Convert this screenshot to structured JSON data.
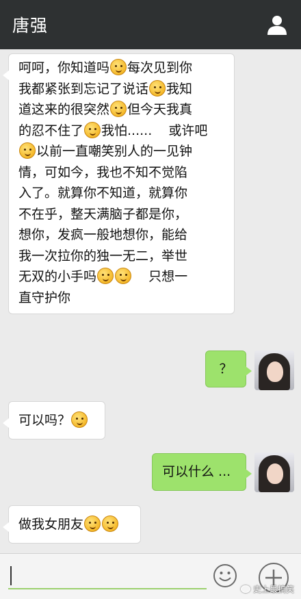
{
  "header": {
    "title": "唐强",
    "profile_icon": "person-icon"
  },
  "messages": [
    {
      "side": "left",
      "lines": [
        [
          "呵呵，你知道吗",
          "E",
          "每次见到你"
        ],
        [
          "我都紧张到忘记了说话",
          "E",
          "我知"
        ],
        [
          "道这来的很突然",
          "E",
          "但今天我真"
        ],
        [
          "的忍不住了",
          "E",
          "我怕......    或许吧"
        ],
        [
          "E",
          "以前一直嘲笑别人的一见钟"
        ],
        [
          "情，可如今，我也不知不觉陷"
        ],
        [
          "入了。就算你不知道，就算你"
        ],
        [
          "不在乎，整天满脑子都是你，"
        ],
        [
          "想你，发疯一般地想你，能给"
        ],
        [
          "我一次拉你的独一无二，举世"
        ],
        [
          "无双的小手吗",
          "E",
          "E",
          "    只想一"
        ],
        [
          "直守护你"
        ]
      ]
    },
    {
      "side": "right",
      "text": "？"
    },
    {
      "side": "left",
      "text": "可以吗？"
    },
    {
      "side": "right",
      "text": "可以什么 ..."
    },
    {
      "side": "left",
      "text": "做我女朋友"
    }
  ],
  "input": {
    "value": ""
  },
  "watermark": "史上最搞笑",
  "colors": {
    "topbar": "#2e3132",
    "sent_bubble": "#9de26c",
    "background": "#ebebeb"
  }
}
